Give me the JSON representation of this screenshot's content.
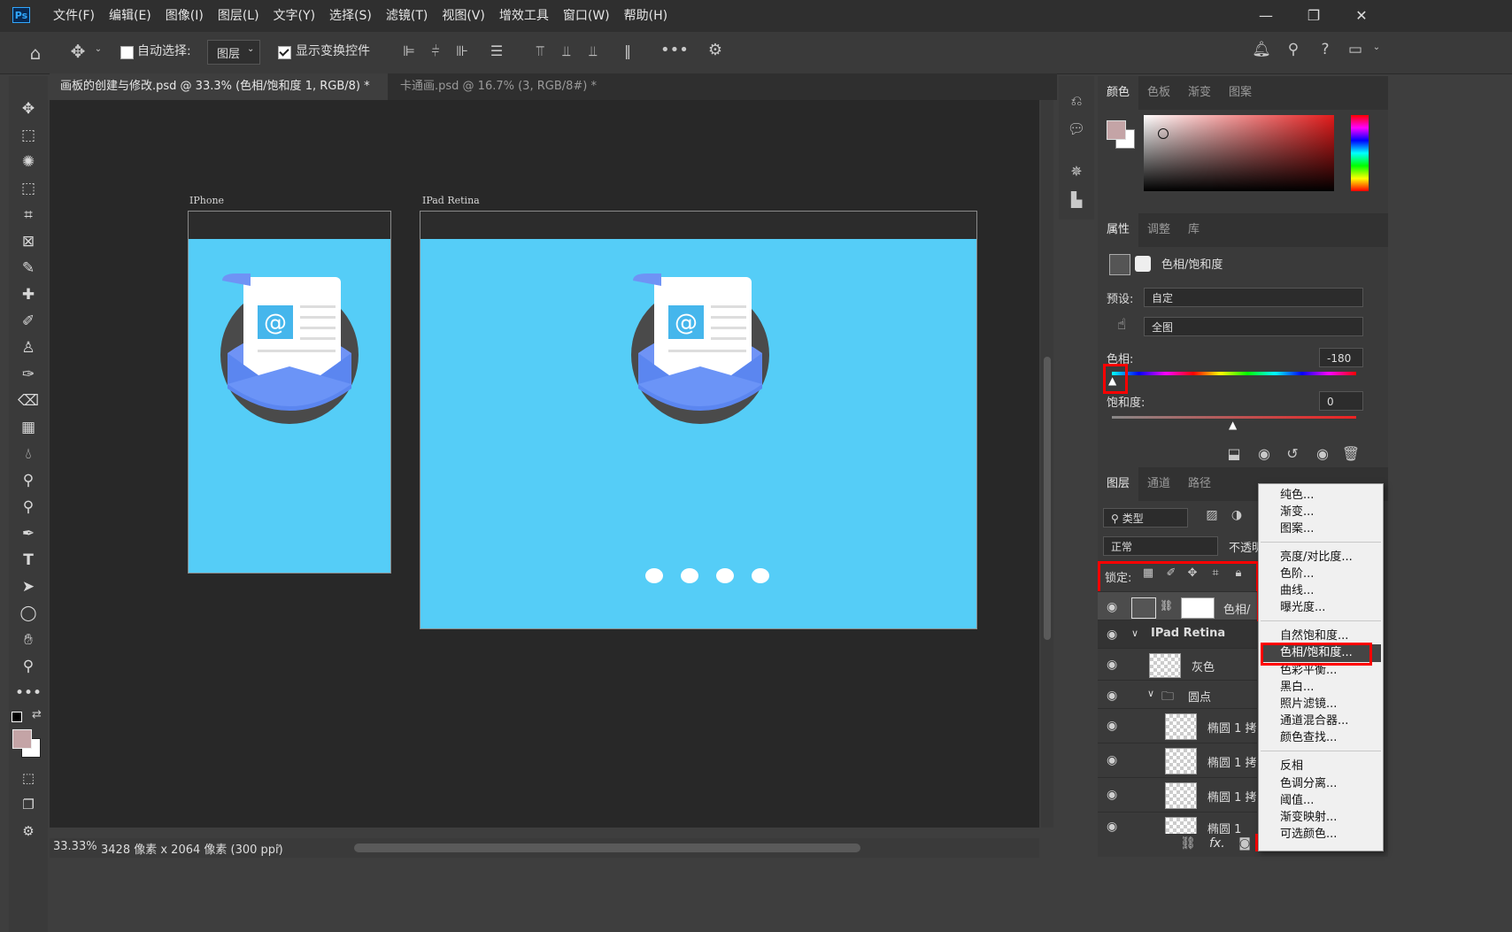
{
  "menubar": {
    "logo": "Ps",
    "items": [
      "文件(F)",
      "编辑(E)",
      "图像(I)",
      "图层(L)",
      "文字(Y)",
      "选择(S)",
      "滤镜(T)",
      "视图(V)",
      "增效工具",
      "窗口(W)",
      "帮助(H)"
    ],
    "win_controls": [
      "—",
      "❐",
      "✕"
    ]
  },
  "options": {
    "auto_select_label": "自动选择:",
    "auto_select_target": "图层",
    "show_transform_label": "显示变换控件"
  },
  "tabs": [
    {
      "label": "画板的创建与修改.psd @ 33.3% (色相/饱和度 1, RGB/8) *",
      "close": "×"
    },
    {
      "label": "卡通画.psd @ 16.7% (3, RGB/8#) *",
      "close": "×"
    }
  ],
  "artboards": {
    "iphone_title": "IPhone",
    "ipad_title": "IPad Retina"
  },
  "colors": {
    "artboard_bg": "#55cdf7",
    "foreground": "#c4a4a6",
    "accent_red": "#ff0000",
    "highlight": "#454545"
  },
  "color_panel": {
    "tabs": [
      "颜色",
      "色板",
      "渐变",
      "图案"
    ]
  },
  "properties_panel": {
    "tabs": [
      "属性",
      "调整",
      "库"
    ],
    "title": "色相/饱和度",
    "preset_label": "预设:",
    "preset_value": "自定",
    "channel_value": "全图",
    "hue_label": "色相:",
    "hue_value": "-180",
    "saturation_label": "饱和度:",
    "saturation_value": "0"
  },
  "layers_panel": {
    "tabs": [
      "图层",
      "通道",
      "路径"
    ],
    "filter_label": "类型",
    "blend_mode": "正常",
    "opacity_label": "不透明",
    "lock_label": "锁定:",
    "rows": [
      {
        "name": "色相/",
        "indent": 0
      },
      {
        "name": "IPad Retina",
        "indent": 0
      },
      {
        "name": "灰色",
        "indent": 1
      },
      {
        "name": "圆点",
        "indent": 1
      },
      {
        "name": "椭圆 1 拷",
        "indent": 2
      },
      {
        "name": "椭圆 1 拷",
        "indent": 2
      },
      {
        "name": "椭圆 1 拷",
        "indent": 2
      },
      {
        "name": "椭圆 1",
        "indent": 2
      }
    ],
    "footer_fx": "fx."
  },
  "adjust_menu": {
    "group1": [
      "纯色...",
      "渐变...",
      "图案..."
    ],
    "group2": [
      "亮度/对比度...",
      "色阶...",
      "曲线...",
      "曝光度..."
    ],
    "group3": [
      "自然饱和度...",
      "色相/饱和度...",
      "色彩平衡...",
      "黑白...",
      "照片滤镜...",
      "通道混合器...",
      "颜色查找..."
    ],
    "group4": [
      "反相",
      "色调分离...",
      "阈值...",
      "渐变映射...",
      "可选颜色..."
    ]
  },
  "status": {
    "zoom": "33.33%",
    "doc_info": "3428 像素 x 2064 像素 (300 ppi)"
  }
}
